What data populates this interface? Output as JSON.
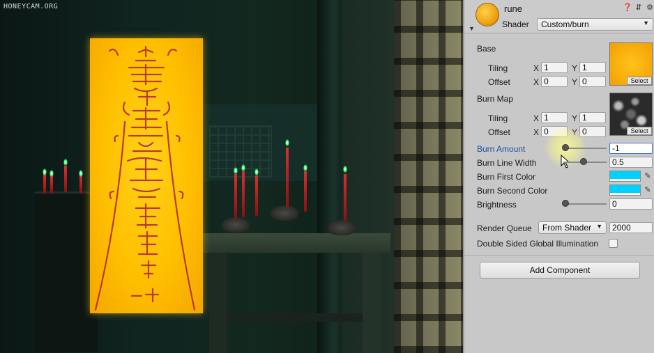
{
  "watermark": "HONEYCAM.ORG",
  "inspector": {
    "object_name": "rune",
    "shader_label": "Shader",
    "shader_value": "Custom/burn",
    "base": {
      "label": "Base",
      "tiling_label": "Tiling",
      "offset_label": "Offset",
      "x_label": "X",
      "y_label": "Y",
      "tiling_x": "1",
      "tiling_y": "1",
      "offset_x": "0",
      "offset_y": "0",
      "select_label": "Select"
    },
    "burn_map": {
      "label": "Burn Map",
      "tiling_label": "Tiling",
      "offset_label": "Offset",
      "x_label": "X",
      "y_label": "Y",
      "tiling_x": "1",
      "tiling_y": "1",
      "offset_x": "0",
      "offset_y": "0",
      "select_label": "Select"
    },
    "burn_amount": {
      "label": "Burn Amount",
      "value": "-1"
    },
    "burn_line_width": {
      "label": "Burn Line Width",
      "value": "0.5"
    },
    "burn_first_color": {
      "label": "Burn First Color",
      "color": "#00d2ff"
    },
    "burn_second_color": {
      "label": "Burn Second Color",
      "color": "#00d2ff"
    },
    "brightness": {
      "label": "Brightness",
      "value": "0"
    },
    "render_queue": {
      "label": "Render Queue",
      "mode": "From Shader",
      "value": "2000"
    },
    "double_sided_gi": {
      "label": "Double Sided Global Illumination",
      "checked": false
    },
    "add_component_label": "Add Component"
  },
  "colors": {
    "panel_bg": "#c8c8c8",
    "active_label": "#1f4f9e",
    "talisman": "#ffbf00",
    "flame": "#3fff7a"
  }
}
